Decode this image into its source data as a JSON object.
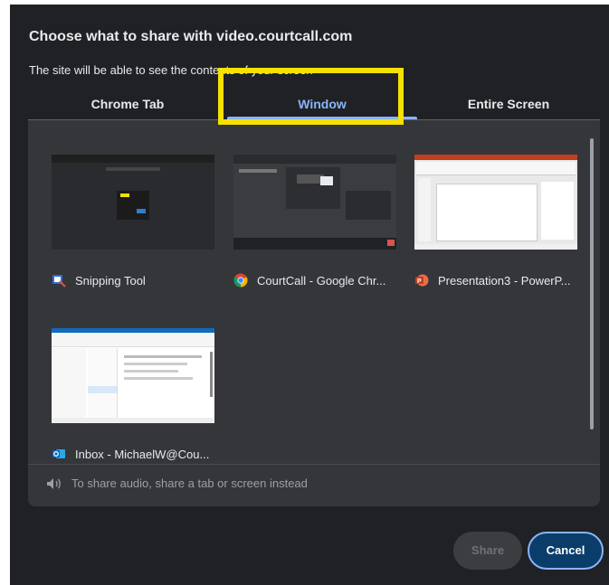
{
  "dialog": {
    "title": "Choose what to share with video.courtcall.com",
    "subtitle": "The site will be able to see the contents of your screen"
  },
  "tabs": [
    {
      "label": "Chrome Tab",
      "active": false
    },
    {
      "label": "Window",
      "active": true
    },
    {
      "label": "Entire Screen",
      "active": false
    }
  ],
  "windows": [
    {
      "label": "Snipping Tool",
      "icon": "snipping-tool-icon"
    },
    {
      "label": "CourtCall - Google Chr...",
      "icon": "chrome-icon"
    },
    {
      "label": "Presentation3 - PowerP...",
      "icon": "powerpoint-icon"
    },
    {
      "label": "Inbox - MichaelW@Cou...",
      "icon": "outlook-icon"
    }
  ],
  "audio_notice": "To share audio, share a tab or screen instead",
  "buttons": {
    "share": "Share",
    "cancel": "Cancel"
  },
  "colors": {
    "dialog_bg": "#202124",
    "panel_bg": "#35363a",
    "accent": "#8ab4f8",
    "highlight": "#f5e102"
  }
}
